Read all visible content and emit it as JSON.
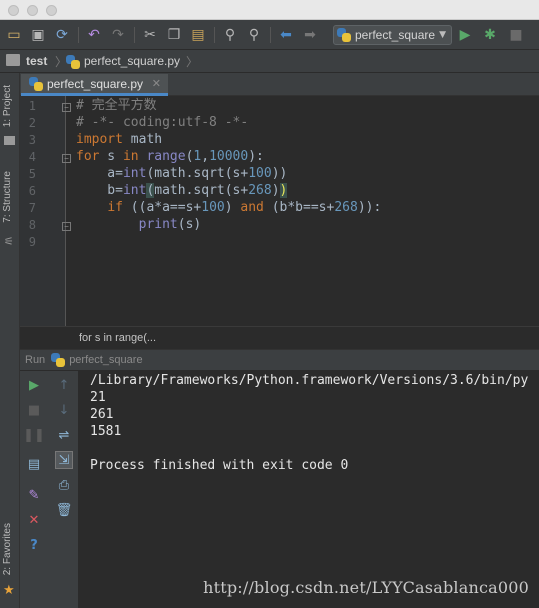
{
  "toolbar": {
    "run_config_label": "perfect_square",
    "icons": [
      "open-folder-icon",
      "save-icon",
      "sync-icon",
      "undo-icon",
      "redo-icon",
      "cut-icon",
      "copy-icon",
      "paste-icon",
      "find-icon",
      "replace-icon",
      "back-icon",
      "forward-icon",
      "run-icon",
      "debug-icon",
      "stop-icon"
    ]
  },
  "navbar": {
    "project": "test",
    "file": "perfect_square.py"
  },
  "sidebar": {
    "project": "1: Project",
    "structure": "7: Structure",
    "favorites": "2: Favorites"
  },
  "editor": {
    "tab_label": "perfect_square.py",
    "line_numbers": [
      "1",
      "2",
      "3",
      "4",
      "5",
      "6",
      "7",
      "8",
      "9"
    ],
    "breadcrumb": "for s in range(..."
  },
  "run": {
    "header_prefix": "Run",
    "header_config": "perfect_square",
    "output": [
      "/Library/Frameworks/Python.framework/Versions/3.6/bin/py",
      "21",
      "261",
      "1581",
      "",
      "Process finished with exit code 0"
    ]
  },
  "watermark": "http://blog.csdn.net/LYYCasablanca000",
  "colors": {
    "keyword": "#cc7832",
    "number": "#6897bb",
    "comment": "#808080",
    "text": "#a9b7c6",
    "builtin": "#8888c6",
    "run_green": "#59a869",
    "stop_red": "#db5860",
    "accent_blue": "#4a88c7"
  }
}
